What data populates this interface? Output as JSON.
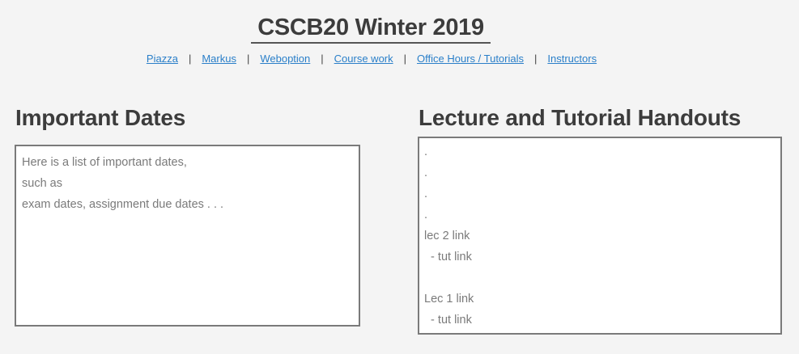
{
  "header": {
    "title": "CSCB20 Winter 2019"
  },
  "nav": {
    "links": [
      "Piazza",
      "Markus",
      "Weboption",
      "Course work",
      "Office Hours / Tutorials",
      "Instructors"
    ],
    "separator": "|"
  },
  "important_dates": {
    "heading": "Important Dates",
    "lines": [
      "Here is a list of important dates,",
      "such as",
      "exam dates, assignment due dates . . ."
    ]
  },
  "handouts": {
    "heading": "Lecture and Tutorial Handouts",
    "dots": [
      ".",
      ".",
      ".",
      "."
    ],
    "lec2_link": "lec 2 link",
    "lec2_tut_prefix": "  - ",
    "lec2_tut_link": "tut link",
    "lec1_link": "Lec 1 link",
    "lec1_tut_prefix": "  - ",
    "lec1_tut_link": "tut link"
  }
}
